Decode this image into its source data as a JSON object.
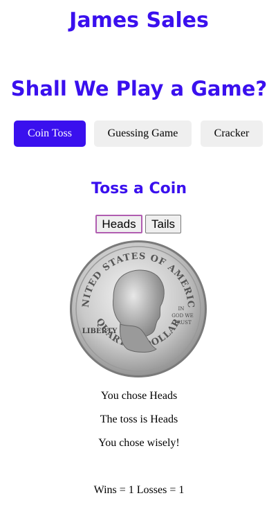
{
  "header": {
    "title": "James Sales",
    "subtitle": "Shall We Play a Game?"
  },
  "nav": {
    "items": [
      {
        "label": "Coin Toss",
        "active": true
      },
      {
        "label": "Guessing Game",
        "active": false
      },
      {
        "label": "Cracker",
        "active": false
      }
    ]
  },
  "coin_toss": {
    "title": "Toss a Coin",
    "heads_label": "Heads",
    "tails_label": "Tails",
    "coin_image": {
      "top_text": "UNITED STATES OF AMERICA",
      "bottom_text": "QUARTER DOLLAR",
      "motto": "IN GOD WE TRUST",
      "left_text": "LIBERTY"
    },
    "choice_message": "You chose Heads",
    "toss_message": "The toss is Heads",
    "result_message": "You chose wisely!",
    "score": "Wins = 1 Losses = 1"
  },
  "colors": {
    "accent": "#3a10ee",
    "button_bg": "#efefef"
  }
}
